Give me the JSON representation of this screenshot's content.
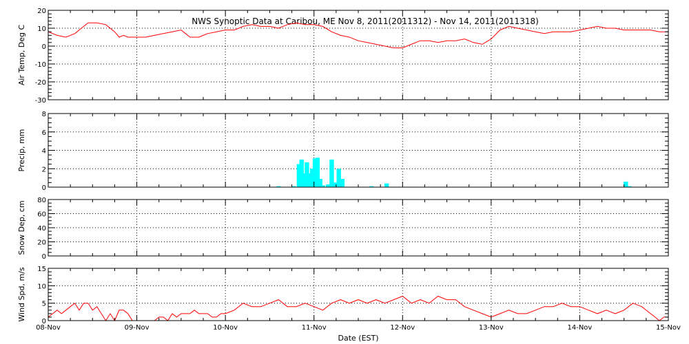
{
  "chart_data": {
    "title": "NWS Synoptic Data at Caribou, ME   Nov  8, 2011(2011312) - Nov 14, 2011(2011318)",
    "xlabel": "Date (EST)",
    "x_ticks": [
      "08-Nov",
      "09-Nov",
      "10-Nov",
      "11-Nov",
      "12-Nov",
      "13-Nov",
      "14-Nov",
      "15-Nov"
    ],
    "x_range_days": [
      0,
      7
    ],
    "grid": "dotted",
    "panels": [
      {
        "type": "line",
        "ylabel": "Air Temp, Deg C",
        "ylim": [
          -30,
          20
        ],
        "yticks": [
          -30,
          -20,
          -10,
          0,
          10,
          20
        ],
        "color": "#ff0000",
        "series": [
          {
            "x": [
              0,
              0.1,
              0.2,
              0.3,
              0.4,
              0.45,
              0.55,
              0.65,
              0.75,
              0.8,
              0.85,
              0.9,
              1.0,
              1.1,
              1.2,
              1.3,
              1.4,
              1.5,
              1.55,
              1.6,
              1.7,
              1.75,
              1.8,
              1.9,
              2.0,
              2.1,
              2.2,
              2.3,
              2.4,
              2.5,
              2.6,
              2.7,
              2.8,
              2.9,
              3.0,
              3.1,
              3.2,
              3.3,
              3.4,
              3.5,
              3.6,
              3.7,
              3.8,
              3.9,
              4.0,
              4.1,
              4.2,
              4.3,
              4.4,
              4.5,
              4.6,
              4.7,
              4.8,
              4.9,
              5.0,
              5.1,
              5.2,
              5.3,
              5.4,
              5.5,
              5.6,
              5.7,
              5.8,
              5.9,
              6.0,
              6.1,
              6.2,
              6.3,
              6.4,
              6.5,
              6.6,
              6.7,
              6.8,
              6.9,
              7.0
            ],
            "y": [
              8,
              6,
              5,
              7,
              11,
              13,
              13,
              12,
              8,
              5,
              6,
              5,
              5,
              5,
              6,
              7,
              8,
              9,
              7,
              5,
              5,
              6,
              7,
              8,
              9,
              9,
              11,
              12,
              11,
              11,
              10,
              12,
              13,
              12,
              12,
              11,
              8,
              6,
              5,
              3,
              2,
              1,
              0,
              -1,
              -1,
              1,
              3,
              3,
              2,
              3,
              3,
              4,
              2,
              1,
              4,
              9,
              11,
              10,
              9,
              8,
              7,
              8,
              8,
              8,
              9,
              10,
              11,
              10,
              10,
              9,
              9,
              9,
              9,
              8,
              8
            ]
          }
        ]
      },
      {
        "type": "bar",
        "ylabel": "Precip, mm",
        "ylim": [
          0,
          8
        ],
        "yticks": [
          0,
          2,
          4,
          6,
          8
        ],
        "color": "#00ffff",
        "series": [
          {
            "x": [
              2.6,
              2.77,
              2.83,
              2.86,
              2.89,
              2.92,
              2.95,
              2.98,
              3.01,
              3.04,
              3.07,
              3.1,
              3.16,
              3.2,
              3.24,
              3.28,
              3.32,
              3.65,
              3.82,
              6.52,
              6.56
            ],
            "y": [
              0.1,
              0.1,
              2.5,
              3.0,
              1.5,
              2.7,
              1.5,
              2.0,
              3.1,
              3.2,
              0.9,
              0.2,
              0.3,
              3.0,
              0.5,
              2.0,
              0.9,
              0.1,
              0.4,
              0.6,
              0.1
            ]
          }
        ]
      },
      {
        "type": "line",
        "ylabel": "Snow Dep, cm",
        "ylim": [
          0,
          80
        ],
        "yticks": [
          0,
          20,
          40,
          60,
          80
        ],
        "color": "#ff0000",
        "series": [
          {
            "x": [],
            "y": []
          }
        ]
      },
      {
        "type": "line",
        "ylabel": "Wind Spd, m/s",
        "ylim": [
          0,
          15
        ],
        "yticks": [
          0,
          5,
          10,
          15
        ],
        "color": "#ff0000",
        "series": [
          {
            "x": [
              0,
              0.05,
              0.1,
              0.15,
              0.2,
              0.25,
              0.3,
              0.35,
              0.4,
              0.45,
              0.5,
              0.55,
              0.6,
              0.65,
              0.7,
              0.75,
              0.8,
              0.85,
              0.9,
              0.95,
              1.0,
              1.05,
              1.1,
              1.15,
              1.2,
              1.25,
              1.3,
              1.35,
              1.4,
              1.45,
              1.5,
              1.55,
              1.6,
              1.65,
              1.7,
              1.75,
              1.8,
              1.85,
              1.9,
              1.95,
              2.0,
              2.1,
              2.2,
              2.3,
              2.4,
              2.5,
              2.6,
              2.7,
              2.8,
              2.9,
              3.0,
              3.1,
              3.2,
              3.3,
              3.4,
              3.5,
              3.6,
              3.7,
              3.8,
              3.9,
              4.0,
              4.1,
              4.2,
              4.3,
              4.4,
              4.5,
              4.6,
              4.7,
              4.8,
              4.9,
              5.0,
              5.1,
              5.2,
              5.3,
              5.4,
              5.5,
              5.6,
              5.7,
              5.8,
              5.9,
              6.0,
              6.1,
              6.2,
              6.3,
              6.4,
              6.5,
              6.6,
              6.7,
              6.8,
              6.85,
              6.9,
              6.95,
              7.0
            ],
            "y": [
              1,
              2,
              3,
              2,
              3,
              4,
              5,
              3,
              5,
              5,
              3,
              4,
              2,
              0,
              2,
              0,
              3,
              3,
              2,
              0,
              0,
              0,
              0,
              0,
              0,
              1,
              1,
              0,
              2,
              1,
              2,
              2,
              2,
              3,
              2,
              2,
              2,
              1,
              1,
              2,
              2,
              3,
              5,
              4,
              4,
              5,
              6,
              4,
              4,
              5,
              4,
              3,
              5,
              6,
              5,
              6,
              5,
              6,
              5,
              6,
              7,
              5,
              6,
              5,
              7,
              6,
              6,
              4,
              3,
              2,
              1,
              2,
              3,
              2,
              2,
              3,
              4,
              4,
              5,
              4,
              4,
              3,
              2,
              3,
              2,
              3,
              5,
              4,
              2,
              1,
              0,
              1,
              1
            ]
          }
        ]
      }
    ]
  }
}
